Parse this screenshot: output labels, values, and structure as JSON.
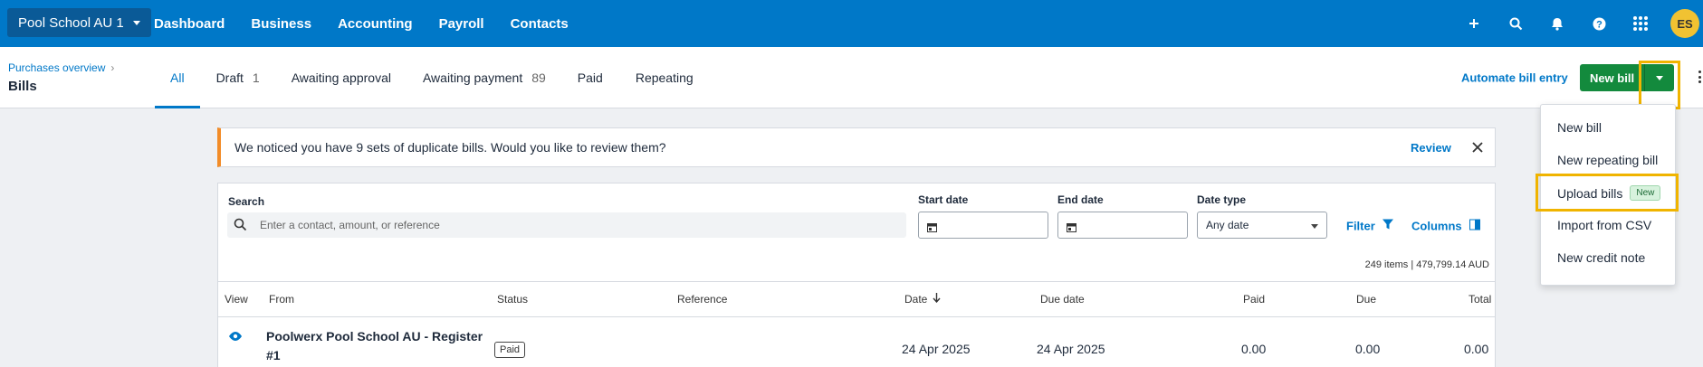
{
  "topnav": {
    "org_name": "Pool School AU 1",
    "links": [
      "Dashboard",
      "Business",
      "Accounting",
      "Payroll",
      "Contacts"
    ],
    "avatar_initials": "ES",
    "background": "#0078c8"
  },
  "header": {
    "breadcrumb": "Purchases overview",
    "title": "Bills",
    "tabs": [
      {
        "label": "All",
        "count": ""
      },
      {
        "label": "Draft",
        "count": "1"
      },
      {
        "label": "Awaiting approval",
        "count": ""
      },
      {
        "label": "Awaiting payment",
        "count": "89"
      },
      {
        "label": "Paid",
        "count": ""
      },
      {
        "label": "Repeating",
        "count": ""
      }
    ],
    "automate_label": "Automate bill entry",
    "new_bill_label": "New bill"
  },
  "banner": {
    "message": "We noticed you have 9 sets of duplicate bills. Would you like to review them?",
    "review_label": "Review"
  },
  "filters": {
    "search_label": "Search",
    "search_placeholder": "Enter a contact, amount, or reference",
    "start_date_label": "Start date",
    "end_date_label": "End date",
    "date_type_label": "Date type",
    "date_type_value": "Any date",
    "filter_label": "Filter",
    "columns_label": "Columns"
  },
  "summary": "249 items | 479,799.14 AUD",
  "table": {
    "headers": [
      "View",
      "From",
      "Status",
      "Reference",
      "Date",
      "Due date",
      "Paid",
      "Due",
      "Total"
    ],
    "rows": [
      {
        "from": "Poolwerx Pool School AU - Register #1",
        "status": "Paid",
        "reference": "",
        "date": "24 Apr 2025",
        "due_date": "24 Apr 2025",
        "paid": "0.00",
        "due": "0.00",
        "total": "0.00"
      }
    ]
  },
  "menu": {
    "items": [
      "New bill",
      "New repeating bill",
      "Upload bills",
      "Import from CSV",
      "New credit note"
    ],
    "new_badge": "New"
  }
}
